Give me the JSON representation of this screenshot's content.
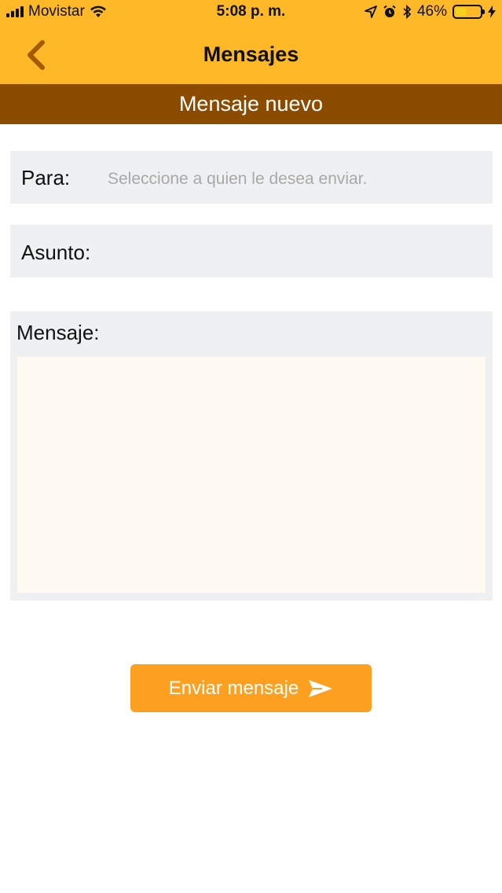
{
  "status_bar": {
    "carrier": "Movistar",
    "time": "5:08 p. m.",
    "battery": "46%",
    "battery_level": 0.46
  },
  "header": {
    "title": "Mensajes",
    "back_icon": "chevron-left-icon"
  },
  "sub_header": {
    "title": "Mensaje nuevo"
  },
  "form": {
    "to_label": "Para:",
    "to_placeholder": "Seleccione a quien le desea enviar.",
    "to_value": "",
    "subject_label": "Asunto:",
    "subject_value": "",
    "message_label": "Mensaje:",
    "message_value": ""
  },
  "send_button": {
    "label": "Enviar mensaje",
    "icon": "send-icon"
  },
  "colors": {
    "header_bg": "#fdb827",
    "sub_header_bg": "#8b4b00",
    "back_icon": "#a35a00",
    "field_bg": "#eef0f2",
    "message_bg": "#fffbf2",
    "button_bg": "#fda01f"
  }
}
